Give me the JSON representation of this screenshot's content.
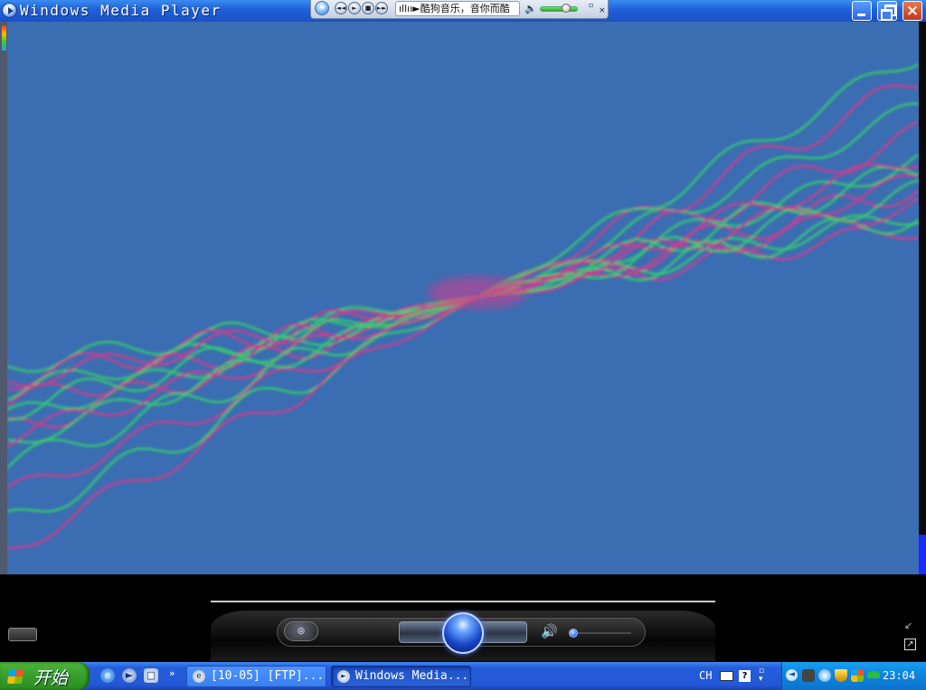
{
  "window": {
    "title": "Windows Media Player",
    "buttons": {
      "minimize": "minimize",
      "maximize": "maximize",
      "close": "×"
    }
  },
  "mini_player": {
    "back_icon": "◄",
    "prev_icon": "◄◄",
    "play_icon": "►",
    "stop_icon": "■",
    "next_icon": "►►",
    "now_playing": "ıllıı►酷狗音乐，音你而酷",
    "volume_icon": "🔈",
    "volume_level": 0.6,
    "restore_icon": "▫",
    "close_icon": "×"
  },
  "visualization": {
    "background": "#3b6db2",
    "wave_colors": [
      "#33d36a",
      "#d83a8c"
    ]
  },
  "controls": {
    "mode_icon": "⊛",
    "volume_icon": "🔊",
    "volume_level": 0.05,
    "shrink_icon": "↙",
    "fullscreen_icon": "↗"
  },
  "taskbar": {
    "start_label": "开始",
    "quick_launch": [
      "ie-icon",
      "media-player-icon",
      "show-desktop-icon"
    ],
    "more": "»",
    "tasks": [
      {
        "label": "[10-05] [FTP]...",
        "icon": "e"
      },
      {
        "label": "Windows Media...",
        "icon": "►"
      }
    ],
    "language": "CH",
    "help": "?",
    "tray_expand": "◄",
    "clock": "23:04"
  }
}
